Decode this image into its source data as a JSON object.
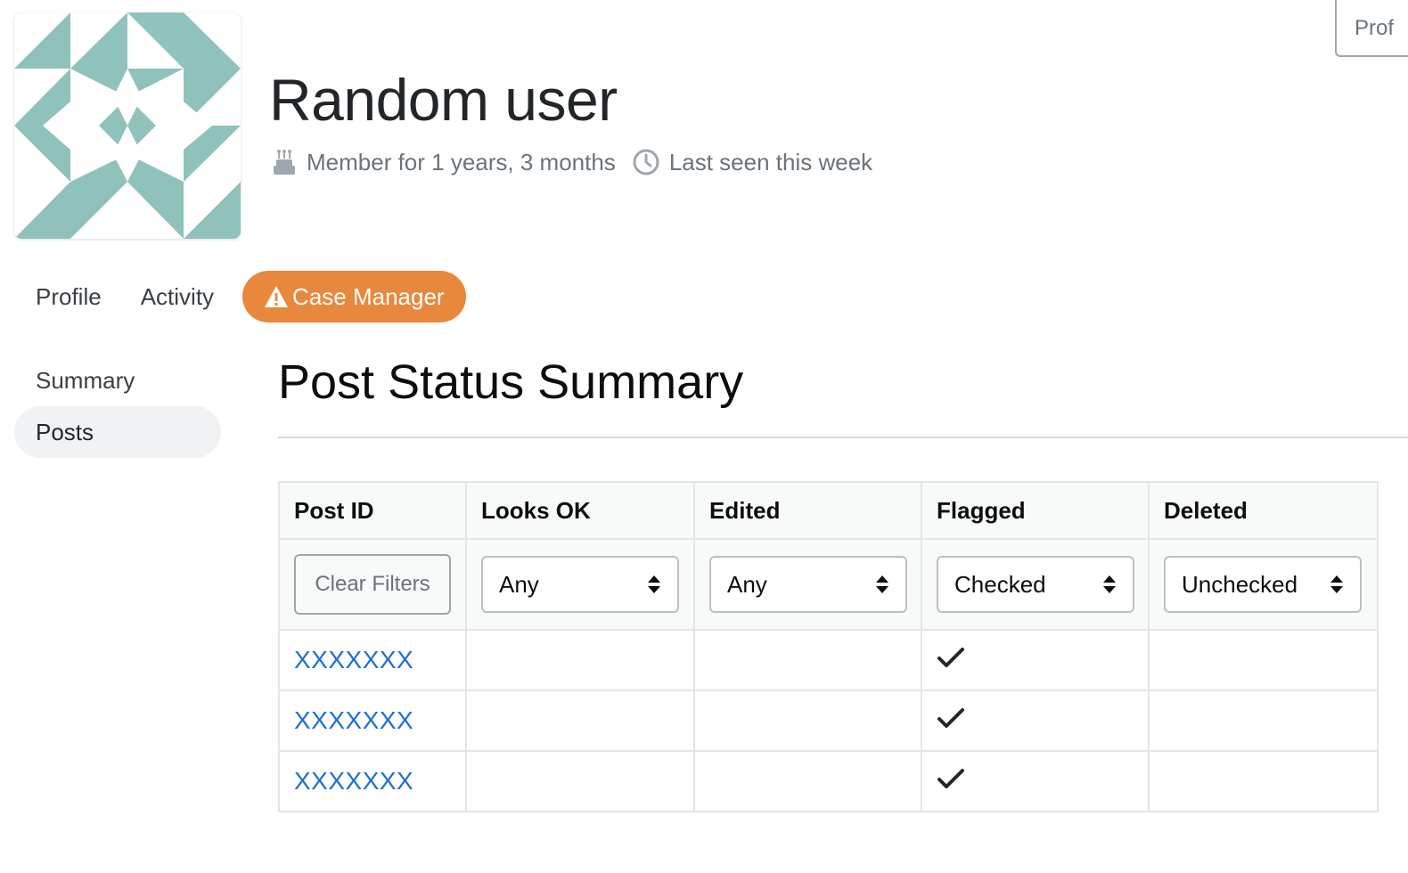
{
  "user": {
    "name": "Random user",
    "member_for": "Member for 1 years, 3 months",
    "last_seen": "Last seen this week"
  },
  "header_button": {
    "label": "Prof"
  },
  "tabs": [
    {
      "label": "Profile",
      "icon": null
    },
    {
      "label": "Activity",
      "icon": null
    },
    {
      "label": "Case Manager",
      "icon": "warning-icon",
      "color": "#e8883d"
    }
  ],
  "sidenav": [
    {
      "label": "Summary",
      "active": false
    },
    {
      "label": "Posts",
      "active": true
    }
  ],
  "section_title": "Post Status Summary",
  "table": {
    "headers": [
      "Post ID",
      "Looks OK",
      "Edited",
      "Flagged",
      "Deleted"
    ],
    "clear_filters_label": "Clear Filters",
    "filters": [
      "Any",
      "Any",
      "Checked",
      "Unchecked"
    ],
    "rows": [
      {
        "post_id": "XXXXXXX",
        "looks_ok": false,
        "edited": false,
        "flagged": true,
        "deleted": false
      },
      {
        "post_id": "XXXXXXX",
        "looks_ok": false,
        "edited": false,
        "flagged": true,
        "deleted": false
      },
      {
        "post_id": "XXXXXXX",
        "looks_ok": false,
        "edited": false,
        "flagged": true,
        "deleted": false
      }
    ]
  },
  "colors": {
    "accent": "#e8883d",
    "link": "#1f6fd1",
    "avatar_teal": "#8fc2ba"
  }
}
